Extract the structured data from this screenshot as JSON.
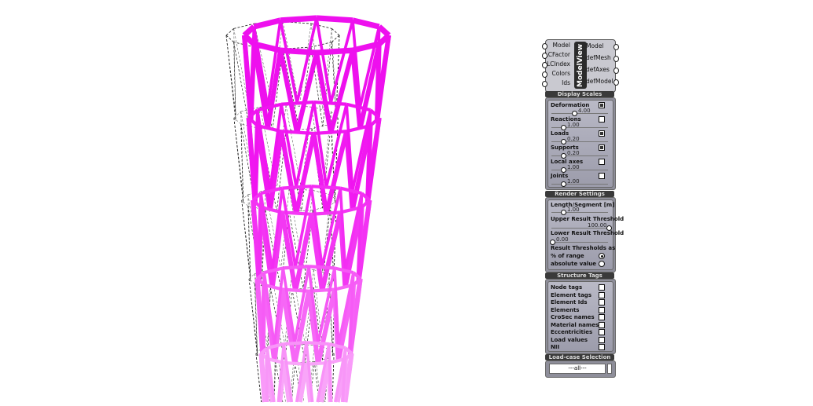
{
  "component": {
    "title": "ModelView",
    "inputs": [
      "Model",
      "LCFactor",
      "LCIndex",
      "Colors",
      "Ids"
    ],
    "outputs": [
      "Model",
      "defMesh",
      "defAxes",
      "defModel"
    ]
  },
  "display_scales": {
    "header": "Display Scales",
    "items": [
      {
        "label": "Deformation",
        "checked": true,
        "value": "4.00",
        "pos": 0.4
      },
      {
        "label": "Reactions",
        "checked": false,
        "value": "1.00",
        "pos": 0.2
      },
      {
        "label": "Loads",
        "checked": true,
        "value": "0.20",
        "pos": 0.2
      },
      {
        "label": "Supports",
        "checked": true,
        "value": "0.20",
        "pos": 0.2
      },
      {
        "label": "Local axes",
        "checked": false,
        "value": "1.00",
        "pos": 0.2
      },
      {
        "label": "Joints",
        "checked": false,
        "value": "1.00",
        "pos": 0.2
      }
    ]
  },
  "render_settings": {
    "header": "Render Settings",
    "length_segment": {
      "label": "Length/Segment [m]",
      "value": "1.00"
    },
    "upper": {
      "label": "Upper Result Threshold",
      "value": "100.00"
    },
    "lower": {
      "label": "Lower Result Threshold",
      "value": "0.00"
    },
    "thresholds_label": "Result Thresholds as",
    "pct_label": "% of range",
    "abs_label": "absolute value",
    "selected": "pct"
  },
  "structure_tags": {
    "header": "Structure Tags",
    "items": [
      "Node tags",
      "Element tags",
      "Element Ids",
      "Elements",
      "CroSec names",
      "Material names",
      "Eccentricities",
      "Load values",
      "NII"
    ]
  },
  "loadcase": {
    "header": "Load-case Selection",
    "value": "---all---"
  },
  "colors": {
    "top": "#ee10ee",
    "bottom": "#f7c8f7"
  }
}
